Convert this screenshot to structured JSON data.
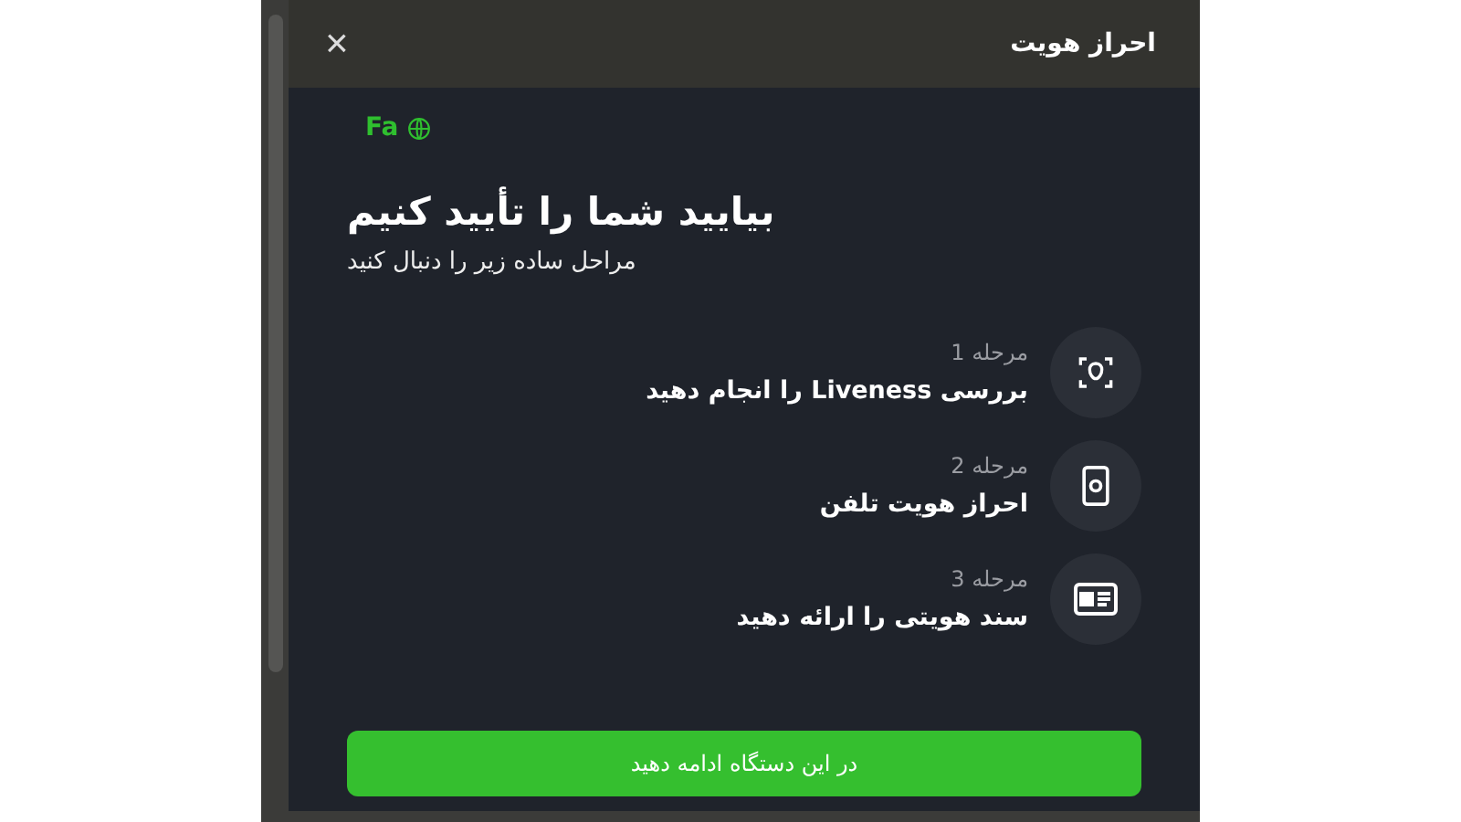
{
  "dialog": {
    "title": "احراز هویت",
    "close": "×"
  },
  "language": {
    "label": "Fa"
  },
  "heading": "بیایید شما را تأیید کنیم",
  "subheading": "مراحل ساده زیر را دنبال کنید",
  "steps": [
    {
      "kind": "face",
      "label": "مرحله 1",
      "text": "بررسی Liveness را انجام دهید"
    },
    {
      "kind": "phone",
      "label": "مرحله 2",
      "text": "احراز هویت تلفن"
    },
    {
      "kind": "card",
      "label": "مرحله 3",
      "text": "سند هویتی را ارائه دهید"
    }
  ],
  "continue_button": "در این دستگاه ادامه دهید"
}
